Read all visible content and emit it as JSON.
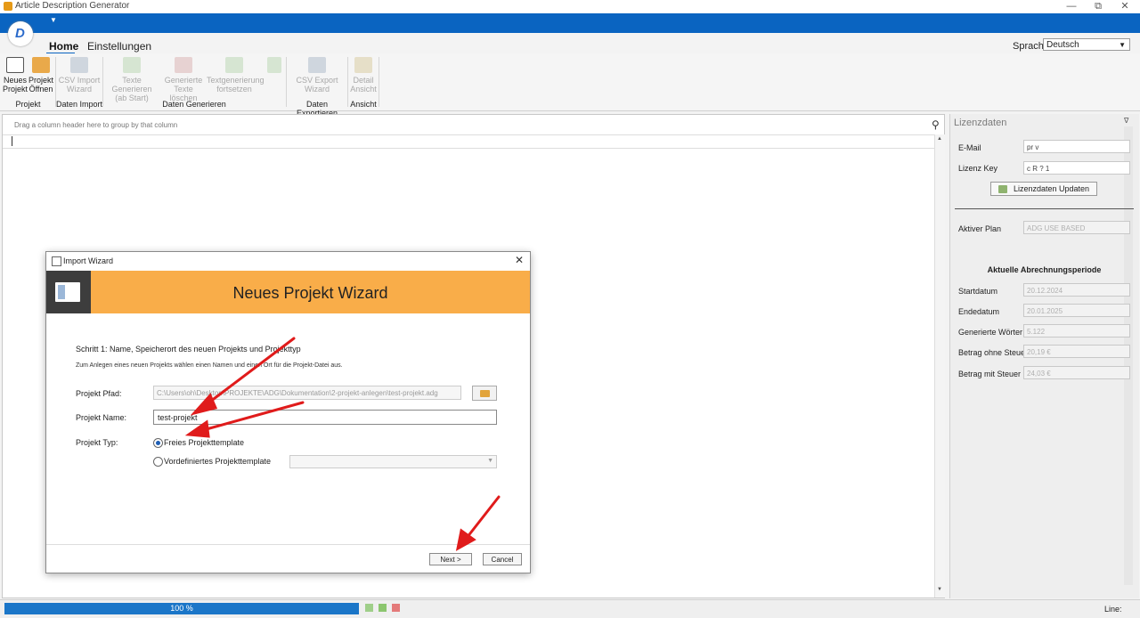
{
  "window": {
    "title": "Article Description Generator",
    "min_icon": "minimize-icon",
    "restore_icon": "restore-icon",
    "close_icon": "close-icon"
  },
  "ribbon": {
    "tabs": [
      {
        "label": "Home",
        "active": true
      },
      {
        "label": "Einstellungen",
        "active": false
      }
    ],
    "language_label": "Sprache:",
    "language_value": "Deutsch",
    "groups": [
      {
        "label": "Projekt",
        "buttons": [
          {
            "l1": "Neues",
            "l2": "Projekt"
          },
          {
            "l1": "Projekt",
            "l2": "Öffnen"
          }
        ]
      },
      {
        "label": "Daten Import",
        "buttons": [
          {
            "l1": "CSV Import",
            "l2": "Wizard"
          }
        ]
      },
      {
        "label": "Daten Generieren",
        "buttons": [
          {
            "l1": "Texte Generieren",
            "l2": "(ab Start)"
          },
          {
            "l1": "Generierte",
            "l2": "Texte löschen"
          },
          {
            "l1": "Textgenerierung",
            "l2": "fortsetzen"
          }
        ]
      },
      {
        "label": "Daten Exportieren",
        "buttons": [
          {
            "l1": "CSV Export",
            "l2": "Wizard"
          }
        ]
      },
      {
        "label": "Ansicht",
        "buttons": [
          {
            "l1": "Detail",
            "l2": "Ansicht"
          }
        ]
      }
    ]
  },
  "grid": {
    "group_hint": "Drag a column header here to group by that column"
  },
  "license_panel": {
    "title": "Lizenzdaten",
    "email_label": "E-Mail",
    "email_value": "pr      v",
    "key_label": "Lizenz Key",
    "key_value": "c      R        ?     1",
    "update_button": "Lizenzdaten Updaten",
    "plan_label": "Aktiver Plan",
    "plan_value": "ADG USE BASED",
    "period_title": "Aktuelle Abrechnungsperiode",
    "rows": [
      {
        "label": "Startdatum",
        "value": "20.12.2024"
      },
      {
        "label": "Endedatum",
        "value": "20.01.2025"
      },
      {
        "label": "Generierte Wörter",
        "value": "5.122"
      },
      {
        "label": "Betrag ohne Steuer",
        "value": "20,19 €"
      },
      {
        "label": "Betrag mit Steuer",
        "value": "24,03 €"
      }
    ]
  },
  "dialog": {
    "title": "Import Wizard",
    "header": "Neues Projekt Wizard",
    "step_title": "Schritt 1: Name, Speicherort des neuen Projekts und Projekttyp",
    "step_desc": "Zum Anlegen eines neuen Projekts wählen einen Namen und einen Ort für die Projekt-Datei aus.",
    "path_label": "Projekt Pfad:",
    "path_value": "C:\\Users\\oh\\Desktop\\PROJEKTE\\ADG\\Dokumentation\\2-projekt-anlegen\\test-projekt.adg",
    "name_label": "Projekt Name:",
    "name_value": "test-projekt",
    "type_label": "Projekt Typ:",
    "type_option_free": "Freies Projekttemplate",
    "type_option_predefined": "Vordefiniertes Projekttemplate",
    "next_button": "Next >",
    "cancel_button": "Cancel"
  },
  "status": {
    "progress": "100 %",
    "progress_fraction": 1.0,
    "line_label": "Line:"
  }
}
